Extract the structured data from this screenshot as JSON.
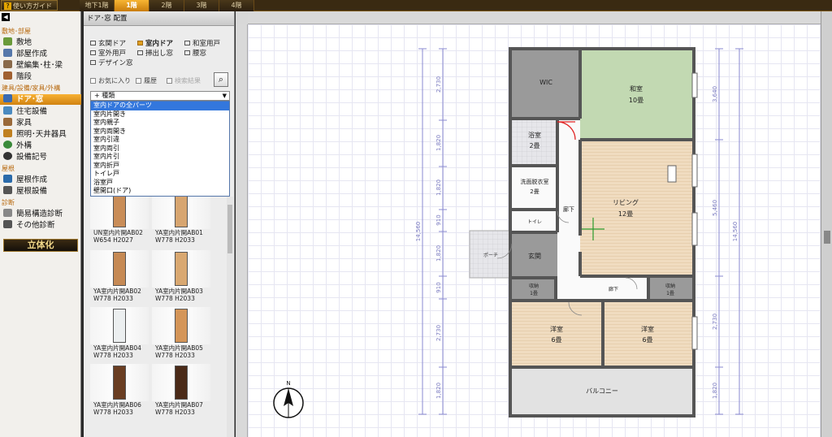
{
  "topbar": {
    "guide_label": "使い方ガイド",
    "floors": [
      "地下1階",
      "1階",
      "2階",
      "3階",
      "4階"
    ],
    "active_floor": "1階"
  },
  "leftmenu": {
    "sections": {
      "site": "敷地･部屋",
      "fixtures": "建具/設備/家具/外構",
      "roof": "屋根",
      "diagnosis": "診断"
    },
    "items": {
      "site": "敷地",
      "room": "部屋作成",
      "wall": "壁編集･柱･梁",
      "stairs": "階段",
      "door": "ドア･窓",
      "equip": "住宅設備",
      "furniture": "家具",
      "light": "照明･天井器具",
      "exterior": "外構",
      "symbol": "設備記号",
      "roofmake": "屋根作成",
      "roofequip": "屋根設備",
      "simple": "簡易構造診断",
      "other": "その他診断"
    },
    "render3d": "立体化"
  },
  "panel": {
    "title": "ドア･窓 配置",
    "categories": [
      "玄関ドア",
      "室内ドア",
      "和室用戸",
      "室外用戸",
      "掃出し窓",
      "腰窓",
      "デザイン窓"
    ],
    "selected_category": "室内ドア",
    "filters": {
      "favorite": "お気に入り",
      "history": "履歴",
      "search_result": "検索結果"
    },
    "type_select": "+ 種類",
    "dropdown_options": [
      "室内ドアの全パーツ",
      "室内片開き",
      "室内親子",
      "室内両開き",
      "室内引違",
      "室内両引",
      "室内片引",
      "室内折戸",
      "トイレ戸",
      "浴室戸",
      "壁開口(ドア)"
    ],
    "highlighted_option": "室内ドアの全パーツ",
    "thumbnails": [
      {
        "name": "UN室内片開AB02",
        "size": "W654 H2027",
        "color": "#c98d58"
      },
      {
        "name": "YA室内片開AB01",
        "size": "W778 H2033",
        "color": "#d7a570"
      },
      {
        "name": "YA室内片開AB02",
        "size": "W778 H2033",
        "color": "#c68a55"
      },
      {
        "name": "YA室内片開AB03",
        "size": "W778 H2033",
        "color": "#d9a871"
      },
      {
        "name": "YA室内片開AB04",
        "size": "W778 H2033",
        "color": "#eceff0"
      },
      {
        "name": "YA室内片開AB05",
        "size": "W778 H2033",
        "color": "#d49558"
      },
      {
        "name": "YA室内片開AB06",
        "size": "W778 H2033",
        "color": "#6a3e22"
      },
      {
        "name": "YA室内片開AB07",
        "size": "W778 H2033",
        "color": "#4a2a18"
      }
    ]
  },
  "plan": {
    "rooms": {
      "wic": "WIC",
      "washitsu": "和室",
      "washitsu_size": "10畳",
      "bath": "浴室",
      "bath_size": "2畳",
      "dressing": "洗面脱衣室",
      "dressing_size": "2畳",
      "toilet": "トイレ",
      "hall_upper": "廊下",
      "living": "リビング",
      "living_size": "12畳",
      "porch": "ポーチ",
      "entrance": "玄関",
      "hall_lower": "廊下",
      "closet_left": "収納",
      "closet_left_size": "1畳",
      "closet_right": "収納",
      "closet_right_size": "1畳",
      "youshitsu_left": "洋室",
      "youshitsu_left_size": "6畳",
      "youshitsu_right": "洋室",
      "youshitsu_right_size": "6畳",
      "balcony": "バルコニー"
    },
    "dims_left": [
      "2,730",
      "1,820",
      "1,820",
      "910",
      "1,820",
      "910",
      "2,730",
      "1,820"
    ],
    "dims_left_total": "14,560",
    "dims_right": [
      "3,640",
      "5,460",
      "2,730",
      "1,820"
    ],
    "dims_right_total": "14,560",
    "north": "N"
  }
}
